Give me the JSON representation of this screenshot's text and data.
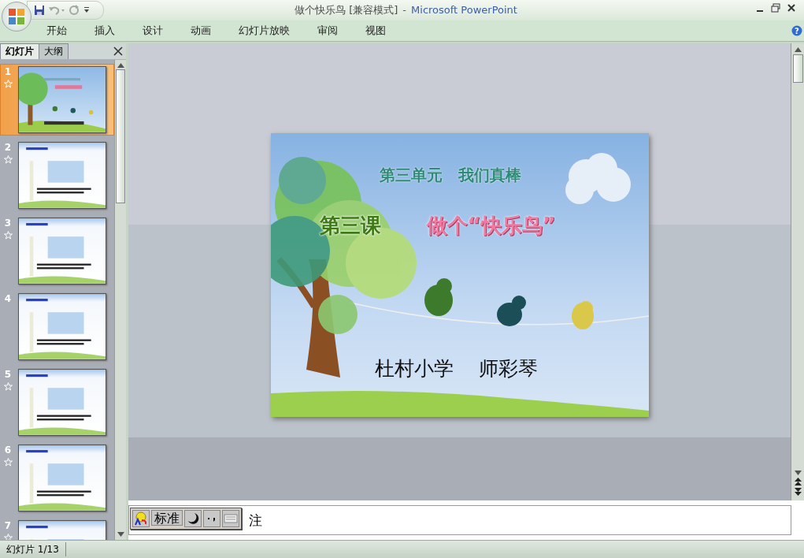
{
  "window": {
    "document_title": "做个快乐鸟 [兼容模式]",
    "separator": "-",
    "app_name": "Microsoft PowerPoint"
  },
  "ribbon_tabs": [
    {
      "label": "开始",
      "selected": false
    },
    {
      "label": "插入",
      "selected": false
    },
    {
      "label": "设计",
      "selected": false
    },
    {
      "label": "动画",
      "selected": false
    },
    {
      "label": "幻灯片放映",
      "selected": false
    },
    {
      "label": "审阅",
      "selected": false
    },
    {
      "label": "视图",
      "selected": false
    }
  ],
  "help": {
    "glyph": "?"
  },
  "pane_tabs": [
    {
      "label": "幻灯片",
      "selected": true
    },
    {
      "label": "大纲",
      "selected": false
    }
  ],
  "slides": [
    {
      "number": "1",
      "selected": true,
      "animated": true
    },
    {
      "number": "2",
      "selected": false,
      "animated": true
    },
    {
      "number": "3",
      "selected": false,
      "animated": true
    },
    {
      "number": "4",
      "selected": false,
      "animated": false
    },
    {
      "number": "5",
      "selected": false,
      "animated": true
    },
    {
      "number": "6",
      "selected": false,
      "animated": true
    },
    {
      "number": "7",
      "selected": false,
      "animated": true
    }
  ],
  "slide": {
    "unit_title": "第三单元　我们真棒",
    "lesson": "第三课",
    "lesson_title": "做个“快乐鸟”",
    "author": "杜村小学　 师彩琴"
  },
  "notes": {
    "text": "注"
  },
  "ime": {
    "mode": "标准"
  },
  "status_bar": {
    "slide_count": "幻灯片 1/13"
  }
}
